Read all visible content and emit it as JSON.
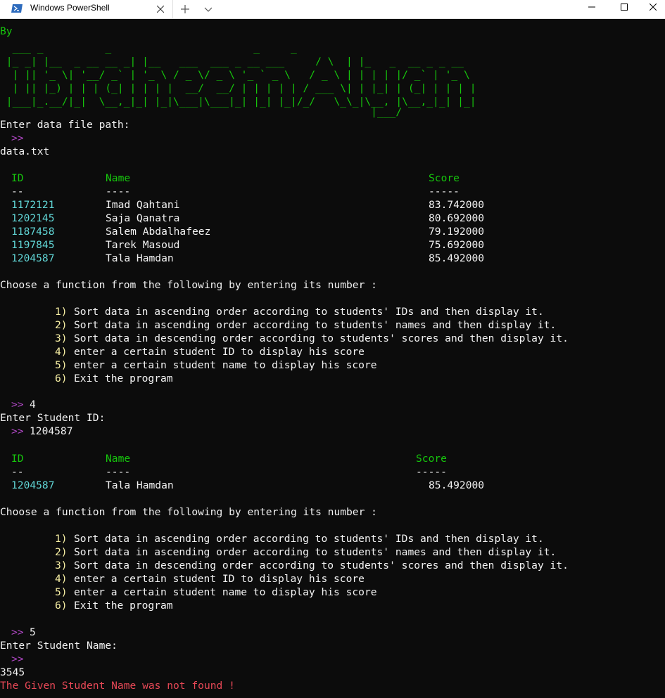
{
  "window": {
    "tab_title": "Windows PowerShell",
    "icons": {
      "tab": "powershell-icon",
      "close_tab": "close-icon",
      "new_tab": "plus-icon",
      "dropdown": "chevron-down-icon",
      "minimize": "minimize-icon",
      "maximize": "maximize-icon",
      "close": "close-icon"
    }
  },
  "colors": {
    "background": "#0c0c0c",
    "green": "#16c60c",
    "cyan": "#61d6d6",
    "yellow": "#f9f1a5",
    "magenta": "#b148c6",
    "red": "#e74856"
  },
  "banner": {
    "by": "By",
    "ascii": [
      "  ___ _          _                       _     _",
      " |_ _| |__  _ __ __ _| |__   ___  ___ _ __ ___     / \\  | |_   _  __ _ _ __ ",
      "  | || '_ \\| '__/ _` | '_ \\ / _ \\/ _ \\ '_ ` _ \\   / _ \\ | | | | |/ _` | '_ \\",
      "  | || |_) | | | (_| | | | |  __/  __/ | | | | | / ___ \\| | |_| | (_| | | | |",
      " |___|_.__/|_|  \\__,_|_| |_|\\___|\\___|_| |_| |_|/_/   \\_\\_|\\__, |\\__,_|_| |_|",
      "                                                            |___/"
    ]
  },
  "session": {
    "file_prompt": "Enter data file path:",
    "prompt_symbol": ">>",
    "file_path": "data.txt",
    "table": {
      "headers": {
        "id": "ID",
        "name": "Name",
        "score": "Score"
      },
      "underlines": {
        "id": "--",
        "name": "----",
        "score": "-----"
      },
      "rows": [
        {
          "id": "1172121",
          "name": "Imad Qahtani",
          "score": "83.742000"
        },
        {
          "id": "1202145",
          "name": "Saja Qanatra",
          "score": "80.692000"
        },
        {
          "id": "1187458",
          "name": "Salem Abdalhafeez",
          "score": "79.192000"
        },
        {
          "id": "1197845",
          "name": "Tarek Masoud",
          "score": "75.692000"
        },
        {
          "id": "1204587",
          "name": "Tala Hamdan",
          "score": "85.492000"
        }
      ]
    },
    "menu_prompt": "Choose a function from the following by entering its number :",
    "menu": [
      {
        "num": "1)",
        "text": "Sort data in ascending order according to students' IDs and then display it."
      },
      {
        "num": "2)",
        "text": "Sort data in ascending order according to students' names and then display it."
      },
      {
        "num": "3)",
        "text": "Sort data in descending order according to students' scores and then display it."
      },
      {
        "num": "4)",
        "text": "enter a certain student ID to display his score"
      },
      {
        "num": "5)",
        "text": "enter a certain student name to display his score"
      },
      {
        "num": "6)",
        "text": "Exit the program"
      }
    ],
    "choice1": "4",
    "id_prompt": "Enter Student ID:",
    "id_value": "1204587",
    "result_table": {
      "headers": {
        "id": "ID",
        "name": "Name",
        "score": "Score"
      },
      "underlines": {
        "id": "--",
        "name": "----",
        "score": "-----"
      },
      "row": {
        "id": "1204587",
        "name": "Tala Hamdan",
        "score": "85.492000"
      }
    },
    "choice2": "5",
    "name_prompt": "Enter Student Name:",
    "name_value": "3545",
    "error": "The Given Student Name was not found !"
  }
}
